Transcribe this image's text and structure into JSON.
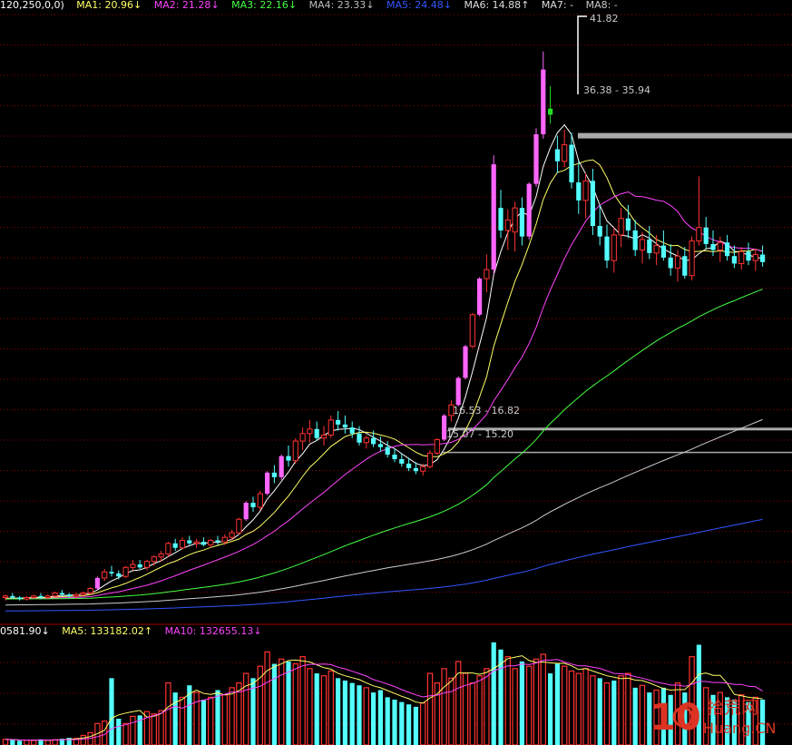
{
  "header": {
    "params": "120,250,0,0)",
    "ma": [
      {
        "label": "MA1: 20.96",
        "arrow": "↓",
        "color": "#ffffff"
      },
      {
        "label": "MA2: 21.28",
        "arrow": "↓",
        "color": "#ffff66"
      },
      {
        "label": "MA3: 22.16",
        "arrow": "↓",
        "color": "#ff44ff"
      },
      {
        "label": "MA4: 23.33",
        "arrow": "↓",
        "color": "#44ff44"
      },
      {
        "label": "MA5: 24.48",
        "arrow": "↓",
        "color": "#bbbbbb"
      },
      {
        "label": "MA6: 14.88",
        "arrow": "↑",
        "color": "#3355ff"
      },
      {
        "label": "MA7: -",
        "arrow": "",
        "color": "#dddddd"
      },
      {
        "label": "MA8: -",
        "arrow": "",
        "color": "#dddddd"
      }
    ]
  },
  "volume_header": [
    {
      "label": "0581.90",
      "arrow": "↓",
      "color": "#ffffff"
    },
    {
      "label": "MA5: 133182.02",
      "arrow": "↑",
      "color": "#ffff66"
    },
    {
      "label": "MA10: 132655.13",
      "arrow": "↓",
      "color": "#ff44ff"
    }
  ],
  "annotations": {
    "high": "41.82",
    "zone_top": "36.38 - 35.94",
    "zone_mid": "16.53 - 16.82",
    "zone_low": "15.07 - 15.20"
  },
  "logo": {
    "number": "10",
    "cn": "拾荒网",
    "url": "Huang.CN"
  },
  "colors": {
    "up": "#ff3232",
    "down": "#54ffff",
    "limit_up": "#ff66ff",
    "grid": "#8b0000"
  },
  "chart_data": {
    "type": "candlestick",
    "ylim": [
      4.2,
      44.5
    ],
    "candles": [
      [
        5.5,
        5.7,
        5.3,
        5.6
      ],
      [
        5.6,
        5.8,
        5.4,
        5.5
      ],
      [
        5.5,
        5.6,
        5.3,
        5.4
      ],
      [
        5.4,
        5.6,
        5.3,
        5.5
      ],
      [
        5.5,
        5.7,
        5.4,
        5.6
      ],
      [
        5.6,
        5.8,
        5.4,
        5.5
      ],
      [
        5.5,
        5.7,
        5.4,
        5.6
      ],
      [
        5.6,
        5.9,
        5.5,
        5.8
      ],
      [
        5.8,
        6.0,
        5.6,
        5.7
      ],
      [
        5.7,
        5.8,
        5.5,
        5.6
      ],
      [
        5.6,
        5.8,
        5.4,
        5.7
      ],
      [
        5.7,
        5.9,
        5.6,
        5.8
      ],
      [
        5.8,
        6.2,
        5.7,
        6.1
      ],
      [
        6.1,
        6.9,
        6.0,
        6.8
      ],
      [
        6.8,
        7.4,
        6.6,
        7.2
      ],
      [
        7.2,
        7.6,
        6.9,
        7.1
      ],
      [
        7.1,
        7.3,
        6.7,
        6.9
      ],
      [
        6.9,
        7.6,
        6.8,
        7.5
      ],
      [
        7.5,
        8.0,
        7.3,
        7.7
      ],
      [
        7.7,
        8.0,
        7.4,
        7.5
      ],
      [
        7.5,
        8.0,
        7.3,
        7.9
      ],
      [
        7.9,
        8.3,
        7.6,
        8.2
      ],
      [
        8.2,
        8.6,
        7.9,
        8.4
      ],
      [
        8.4,
        9.2,
        8.2,
        9.1
      ],
      [
        9.1,
        9.4,
        8.6,
        8.8
      ],
      [
        8.8,
        9.5,
        8.7,
        9.3
      ],
      [
        9.3,
        9.6,
        9.0,
        9.1
      ],
      [
        9.1,
        9.4,
        8.8,
        9.2
      ],
      [
        9.2,
        9.5,
        8.9,
        9.0
      ],
      [
        9.0,
        9.4,
        8.8,
        9.3
      ],
      [
        9.3,
        9.6,
        9.0,
        9.2
      ],
      [
        9.2,
        9.7,
        9.0,
        9.5
      ],
      [
        9.5,
        10.0,
        9.3,
        9.8
      ],
      [
        9.8,
        10.8,
        9.7,
        10.7
      ],
      [
        10.7,
        11.9,
        10.6,
        11.8
      ],
      [
        11.8,
        12.2,
        11.2,
        11.5
      ],
      [
        11.5,
        12.6,
        11.3,
        12.4
      ],
      [
        12.4,
        13.9,
        12.3,
        13.8
      ],
      [
        13.8,
        14.3,
        13.1,
        13.5
      ],
      [
        13.5,
        15.0,
        13.3,
        14.9
      ],
      [
        14.9,
        15.6,
        14.2,
        14.6
      ],
      [
        14.6,
        16.1,
        14.4,
        15.9
      ],
      [
        15.9,
        16.8,
        15.3,
        16.4
      ],
      [
        16.4,
        17.3,
        15.8,
        16.7
      ],
      [
        16.7,
        17.2,
        15.9,
        16.1
      ],
      [
        16.1,
        16.9,
        15.6,
        16.3
      ],
      [
        16.3,
        17.6,
        16.1,
        17.3
      ],
      [
        17.3,
        17.9,
        16.6,
        17.0
      ],
      [
        17.0,
        17.6,
        16.4,
        16.8
      ],
      [
        16.8,
        17.2,
        16.1,
        16.4
      ],
      [
        16.4,
        16.9,
        15.6,
        15.8
      ],
      [
        15.8,
        16.3,
        15.4,
        16.1
      ],
      [
        16.1,
        16.6,
        15.5,
        15.7
      ],
      [
        15.7,
        16.2,
        15.2,
        15.5
      ],
      [
        15.5,
        15.9,
        14.8,
        15.0
      ],
      [
        15.0,
        15.4,
        14.5,
        14.7
      ],
      [
        14.7,
        15.1,
        14.2,
        14.4
      ],
      [
        14.4,
        14.8,
        13.9,
        14.1
      ],
      [
        14.1,
        14.5,
        13.7,
        13.9
      ],
      [
        13.9,
        14.4,
        13.6,
        14.2
      ],
      [
        14.2,
        15.3,
        14.1,
        15.1
      ],
      [
        15.1,
        16.1,
        15.0,
        16.0
      ],
      [
        16.0,
        17.7,
        15.9,
        17.6
      ],
      [
        17.6,
        18.6,
        17.2,
        18.3
      ],
      [
        18.3,
        20.2,
        18.2,
        20.1
      ],
      [
        20.1,
        22.3,
        20.0,
        22.2
      ],
      [
        22.2,
        24.4,
        22.1,
        24.3
      ],
      [
        24.3,
        26.8,
        24.2,
        26.7
      ],
      [
        26.7,
        28.3,
        25.8,
        27.3
      ],
      [
        27.3,
        34.9,
        27.0,
        34.3
      ],
      [
        31.4,
        32.6,
        29.4,
        29.9
      ],
      [
        29.9,
        31.3,
        28.6,
        30.6
      ],
      [
        29.8,
        31.8,
        28.5,
        31.4
      ],
      [
        31.4,
        32.1,
        28.9,
        29.5
      ],
      [
        29.5,
        33.1,
        29.3,
        33.0
      ],
      [
        33.0,
        36.7,
        32.8,
        36.3
      ],
      [
        36.3,
        41.8,
        36.0,
        40.6
      ],
      [
        38.0,
        39.5,
        37.0,
        37.6
      ],
      [
        35.3,
        36.2,
        33.7,
        34.5
      ],
      [
        34.5,
        36.6,
        34.1,
        35.6
      ],
      [
        35.6,
        36.4,
        32.7,
        33.1
      ],
      [
        33.1,
        34.5,
        31.0,
        31.9
      ],
      [
        31.9,
        33.7,
        30.7,
        33.2
      ],
      [
        33.2,
        34.0,
        29.6,
        30.2
      ],
      [
        30.2,
        31.6,
        28.9,
        29.5
      ],
      [
        29.5,
        30.3,
        27.4,
        27.9
      ],
      [
        27.9,
        30.1,
        27.1,
        29.6
      ],
      [
        29.6,
        31.4,
        28.8,
        30.7
      ],
      [
        30.7,
        31.6,
        29.4,
        29.9
      ],
      [
        29.9,
        30.6,
        28.2,
        28.6
      ],
      [
        28.6,
        29.8,
        27.7,
        29.3
      ],
      [
        29.3,
        30.2,
        28.0,
        28.4
      ],
      [
        28.4,
        29.6,
        27.6,
        28.9
      ],
      [
        28.9,
        29.9,
        27.9,
        28.1
      ],
      [
        28.1,
        29.0,
        26.9,
        27.4
      ],
      [
        27.4,
        28.6,
        26.5,
        28.2
      ],
      [
        28.2,
        28.8,
        26.7,
        26.9
      ],
      [
        26.9,
        29.5,
        26.6,
        29.2
      ],
      [
        29.2,
        33.5,
        28.9,
        30.1
      ],
      [
        30.1,
        30.8,
        28.7,
        29.0
      ],
      [
        29.0,
        29.9,
        28.2,
        28.6
      ],
      [
        28.6,
        29.5,
        27.8,
        29.1
      ],
      [
        29.1,
        29.6,
        27.9,
        28.2
      ],
      [
        28.2,
        28.9,
        27.4,
        27.7
      ],
      [
        27.7,
        28.8,
        27.3,
        28.5
      ],
      [
        28.5,
        29.1,
        27.6,
        27.9
      ],
      [
        27.9,
        28.7,
        27.2,
        28.3
      ],
      [
        28.3,
        28.9,
        27.5,
        27.8
      ]
    ],
    "volume": [
      {
        "v": 12000,
        "up": true
      },
      {
        "v": 11000,
        "up": false
      },
      {
        "v": 9000,
        "up": false
      },
      {
        "v": 10000,
        "up": true
      },
      {
        "v": 9500,
        "up": true
      },
      {
        "v": 12000,
        "up": false
      },
      {
        "v": 10000,
        "up": true
      },
      {
        "v": 11000,
        "up": true
      },
      {
        "v": 13000,
        "up": false
      },
      {
        "v": 15000,
        "up": false
      },
      {
        "v": 14000,
        "up": true
      },
      {
        "v": 20000,
        "up": true
      },
      {
        "v": 26000,
        "up": true
      },
      {
        "v": 45000,
        "up": true
      },
      {
        "v": 50000,
        "up": true
      },
      {
        "v": 140000,
        "up": false
      },
      {
        "v": 55000,
        "up": false
      },
      {
        "v": 45000,
        "up": true
      },
      {
        "v": 60000,
        "up": true
      },
      {
        "v": 62000,
        "up": false
      },
      {
        "v": 70000,
        "up": true
      },
      {
        "v": 65000,
        "up": true
      },
      {
        "v": 72000,
        "up": true
      },
      {
        "v": 130000,
        "up": true
      },
      {
        "v": 110000,
        "up": false
      },
      {
        "v": 100000,
        "up": true
      },
      {
        "v": 125000,
        "up": false
      },
      {
        "v": 110000,
        "up": true
      },
      {
        "v": 95000,
        "up": false
      },
      {
        "v": 100000,
        "up": true
      },
      {
        "v": 115000,
        "up": false
      },
      {
        "v": 105000,
        "up": true
      },
      {
        "v": 120000,
        "up": true
      },
      {
        "v": 130000,
        "up": true
      },
      {
        "v": 150000,
        "up": true
      },
      {
        "v": 140000,
        "up": false
      },
      {
        "v": 165000,
        "up": true
      },
      {
        "v": 195000,
        "up": true
      },
      {
        "v": 170000,
        "up": false
      },
      {
        "v": 180000,
        "up": true
      },
      {
        "v": 175000,
        "up": false
      },
      {
        "v": 170000,
        "up": true
      },
      {
        "v": 185000,
        "up": true
      },
      {
        "v": 160000,
        "up": true
      },
      {
        "v": 150000,
        "up": false
      },
      {
        "v": 145000,
        "up": true
      },
      {
        "v": 155000,
        "up": true
      },
      {
        "v": 140000,
        "up": false
      },
      {
        "v": 135000,
        "up": false
      },
      {
        "v": 130000,
        "up": false
      },
      {
        "v": 125000,
        "up": false
      },
      {
        "v": 120000,
        "up": true
      },
      {
        "v": 110000,
        "up": false
      },
      {
        "v": 115000,
        "up": false
      },
      {
        "v": 100000,
        "up": false
      },
      {
        "v": 95000,
        "up": false
      },
      {
        "v": 90000,
        "up": false
      },
      {
        "v": 85000,
        "up": false
      },
      {
        "v": 80000,
        "up": false
      },
      {
        "v": 88000,
        "up": true
      },
      {
        "v": 150000,
        "up": true
      },
      {
        "v": 130000,
        "up": true
      },
      {
        "v": 160000,
        "up": true
      },
      {
        "v": 140000,
        "up": true
      },
      {
        "v": 175000,
        "up": true
      },
      {
        "v": 150000,
        "up": true
      },
      {
        "v": 130000,
        "up": true
      },
      {
        "v": 145000,
        "up": true
      },
      {
        "v": 160000,
        "up": true
      },
      {
        "v": 215000,
        "up": false
      },
      {
        "v": 200000,
        "up": false
      },
      {
        "v": 185000,
        "up": true
      },
      {
        "v": 160000,
        "up": true
      },
      {
        "v": 175000,
        "up": false
      },
      {
        "v": 165000,
        "up": true
      },
      {
        "v": 180000,
        "up": true
      },
      {
        "v": 190000,
        "up": true
      },
      {
        "v": 150000,
        "up": false
      },
      {
        "v": 170000,
        "up": false
      },
      {
        "v": 165000,
        "up": true
      },
      {
        "v": 155000,
        "up": true
      },
      {
        "v": 150000,
        "up": true
      },
      {
        "v": 160000,
        "up": true
      },
      {
        "v": 145000,
        "up": true
      },
      {
        "v": 140000,
        "up": false
      },
      {
        "v": 130000,
        "up": true
      },
      {
        "v": 135000,
        "up": false
      },
      {
        "v": 145000,
        "up": true
      },
      {
        "v": 150000,
        "up": true
      },
      {
        "v": 120000,
        "up": false
      },
      {
        "v": 125000,
        "up": true
      },
      {
        "v": 110000,
        "up": false
      },
      {
        "v": 115000,
        "up": true
      },
      {
        "v": 120000,
        "up": false
      },
      {
        "v": 105000,
        "up": false
      },
      {
        "v": 130000,
        "up": true
      },
      {
        "v": 110000,
        "up": false
      },
      {
        "v": 185000,
        "up": true
      },
      {
        "v": 210000,
        "up": false
      },
      {
        "v": 120000,
        "up": true
      },
      {
        "v": 105000,
        "up": false
      },
      {
        "v": 110000,
        "up": true
      },
      {
        "v": 100000,
        "up": false
      },
      {
        "v": 95000,
        "up": false
      },
      {
        "v": 105000,
        "up": true
      },
      {
        "v": 90000,
        "up": false
      },
      {
        "v": 100000,
        "up": true
      },
      {
        "v": 95000,
        "up": false
      }
    ],
    "vol_ylim": [
      0,
      230000
    ]
  }
}
